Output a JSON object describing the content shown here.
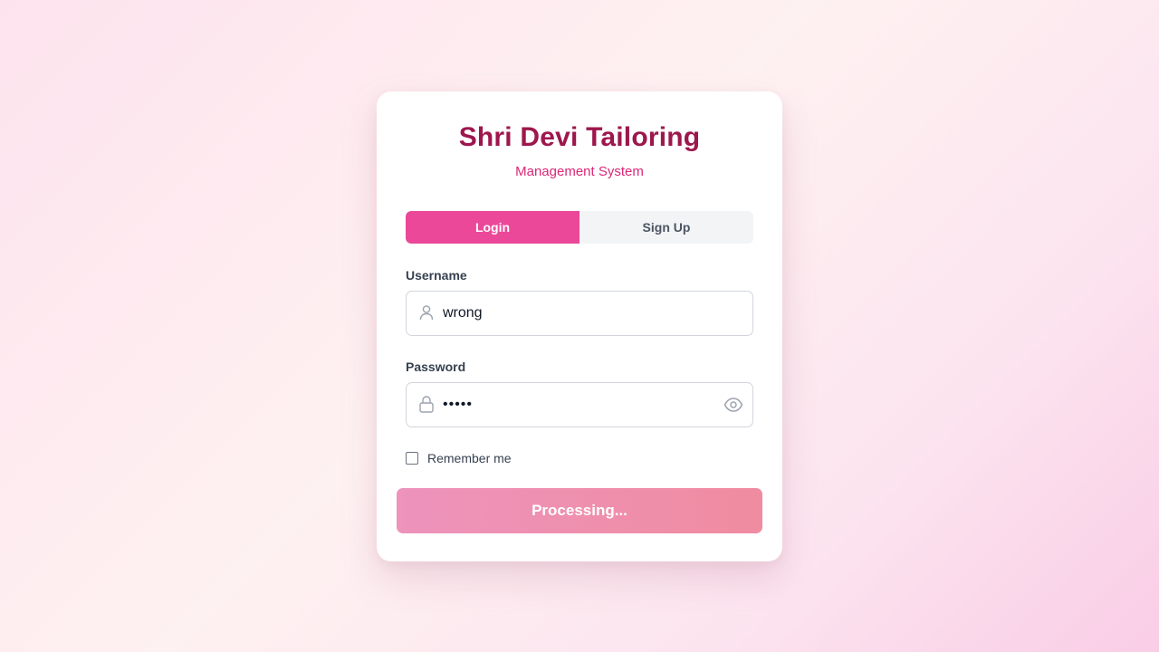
{
  "app": {
    "title": "Shri Devi Tailoring",
    "subtitle": "Management System"
  },
  "tabs": [
    {
      "label": "Login",
      "active": true
    },
    {
      "label": "Sign Up",
      "active": false
    }
  ],
  "form": {
    "username_label": "Username",
    "username_value": "wrong",
    "password_label": "Password",
    "password_value": "•••••",
    "remember_label": "Remember me",
    "remember_checked": false,
    "submit_label": "Processing..."
  },
  "icons": {
    "username": "user-icon",
    "password": "lock-icon",
    "toggle_visibility": "eye-icon"
  },
  "colors": {
    "title": "#9d174d",
    "subtitle": "#db2777",
    "active_tab": "#ec4899",
    "submit_gradient_start": "#ed93bc",
    "submit_gradient_end": "#f08ca0"
  }
}
